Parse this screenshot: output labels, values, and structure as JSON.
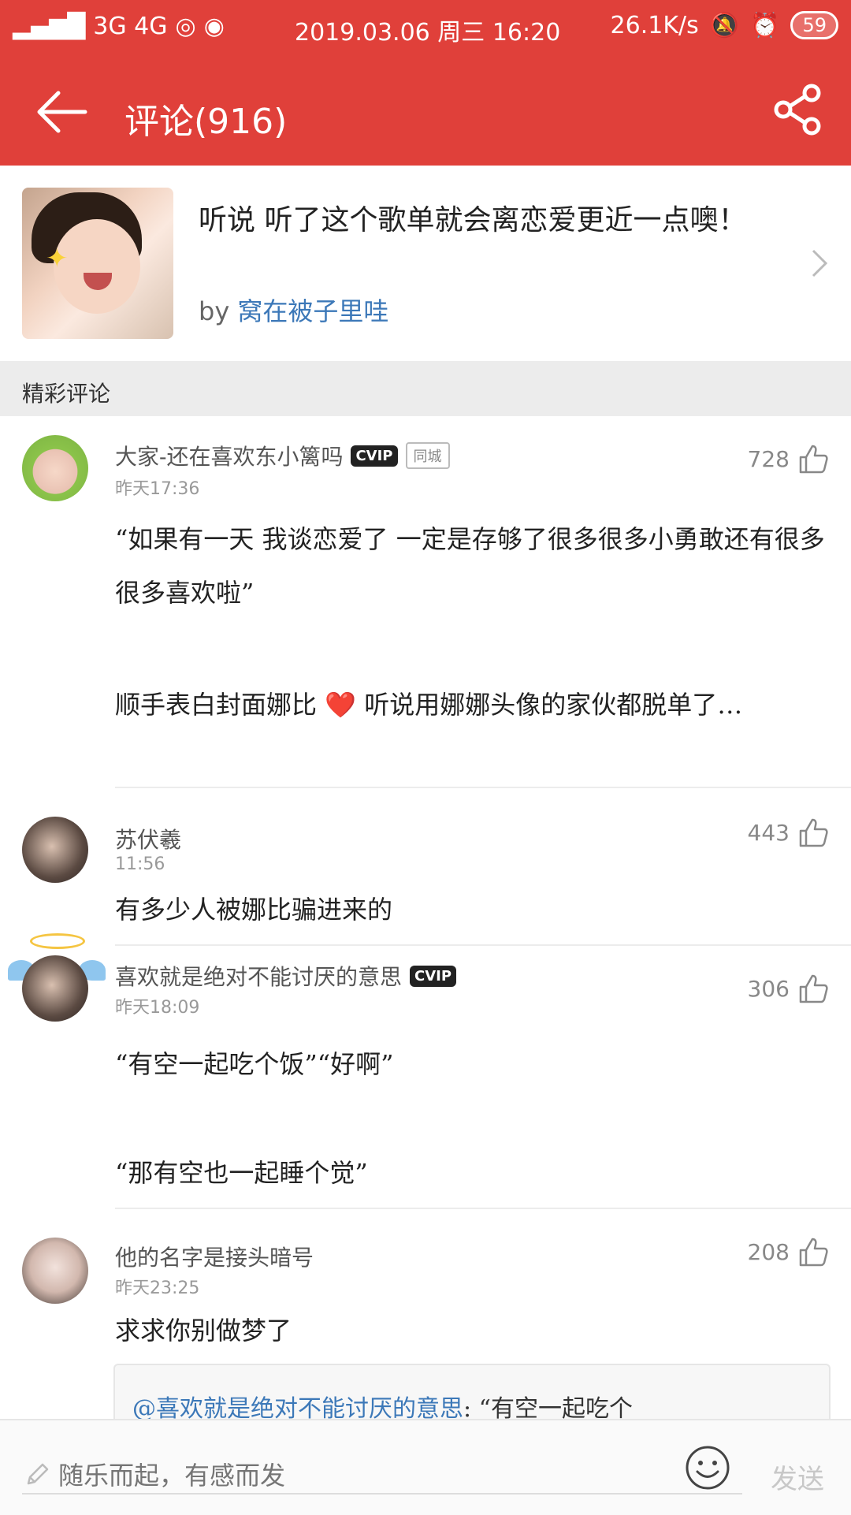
{
  "status_bar": {
    "network": "3G 4G",
    "datetime": "2019.03.06 周三 16:20",
    "speed": "26.1K/s",
    "battery": "59"
  },
  "header": {
    "title": "评论(916)"
  },
  "playlist": {
    "title": "听说 听了这个歌单就会离恋爱更近一点噢！",
    "by_label": "by",
    "author": "窝在被子里哇"
  },
  "section": {
    "label": "精彩评论"
  },
  "comments": [
    {
      "user": "大家-还在喜欢东小篱吗",
      "vip": "CVIP",
      "city": "同城",
      "time": "昨天17:36",
      "likes": "728",
      "text1": "“如果有一天 我谈恋爱了 一定是存够了很多很多小勇敢还有很多很多喜欢啦”",
      "text2": "顺手表白封面娜比 ❤️ 听说用娜娜头像的家伙都脱单了…"
    },
    {
      "user": "苏伏羲",
      "time": "11:56",
      "likes": "443",
      "text1": "有多少人被娜比骗进来的"
    },
    {
      "user": "喜欢就是绝对不能讨厌的意思",
      "vip": "CVIP",
      "time": "昨天18:09",
      "likes": "306",
      "text1": "“有空一起吃个饭”“好啊”",
      "text2": "“那有空也一起睡个觉”"
    },
    {
      "user": "他的名字是接头暗号",
      "time": "昨天23:25",
      "likes": "208",
      "text1": "求求你别做梦了",
      "reply_user": "@喜欢就是绝对不能讨厌的意思",
      "reply_text": ": “有空一起吃个"
    }
  ],
  "input": {
    "placeholder": "随乐而起，有感而发",
    "send_label": "发送"
  },
  "colors": {
    "brand_red": "#e0403a",
    "link_blue": "#3c78b8"
  }
}
